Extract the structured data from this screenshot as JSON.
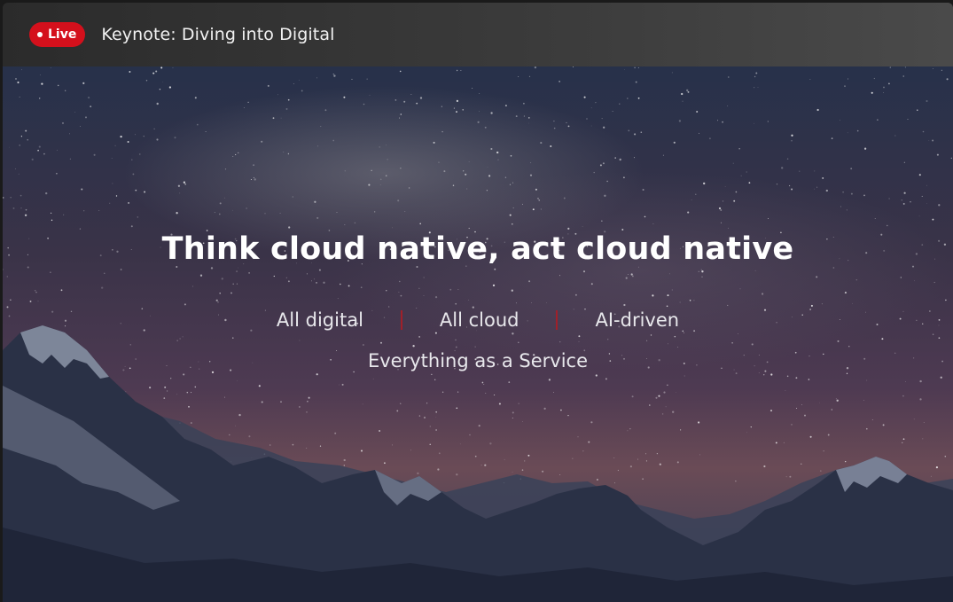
{
  "header": {
    "live_label": "Live",
    "title": "Keynote: Diving into Digital"
  },
  "slide": {
    "headline": "Think cloud native, act cloud native",
    "pillars": [
      "All digital",
      "All cloud",
      "AI-driven"
    ],
    "subline": "Everything as a Service"
  },
  "colors": {
    "live_badge": "#d4101c",
    "divider": "#a0202a"
  }
}
